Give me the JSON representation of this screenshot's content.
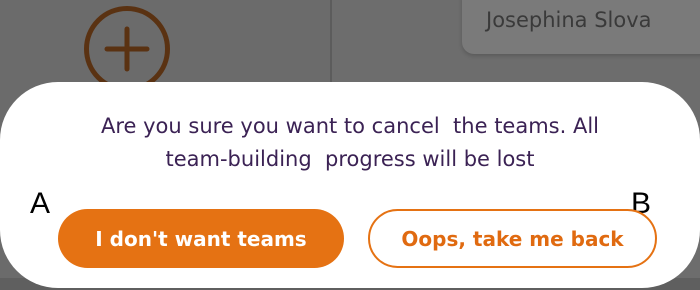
{
  "background": {
    "user_name": "Josephina Slova",
    "add_icon": "plus-circle-icon"
  },
  "dialog": {
    "message_line1": "Are you sure you want to cancel  the teams. All",
    "message_line2": "team-building  progress will be lost",
    "primary_button_label": "I don't want teams",
    "secondary_button_label": "Oops, take me back"
  },
  "markers": {
    "a": "A",
    "b": "B"
  },
  "colors": {
    "accent": "#e57213",
    "message_text": "#3b2254",
    "overlay": "#6e6e6e"
  }
}
